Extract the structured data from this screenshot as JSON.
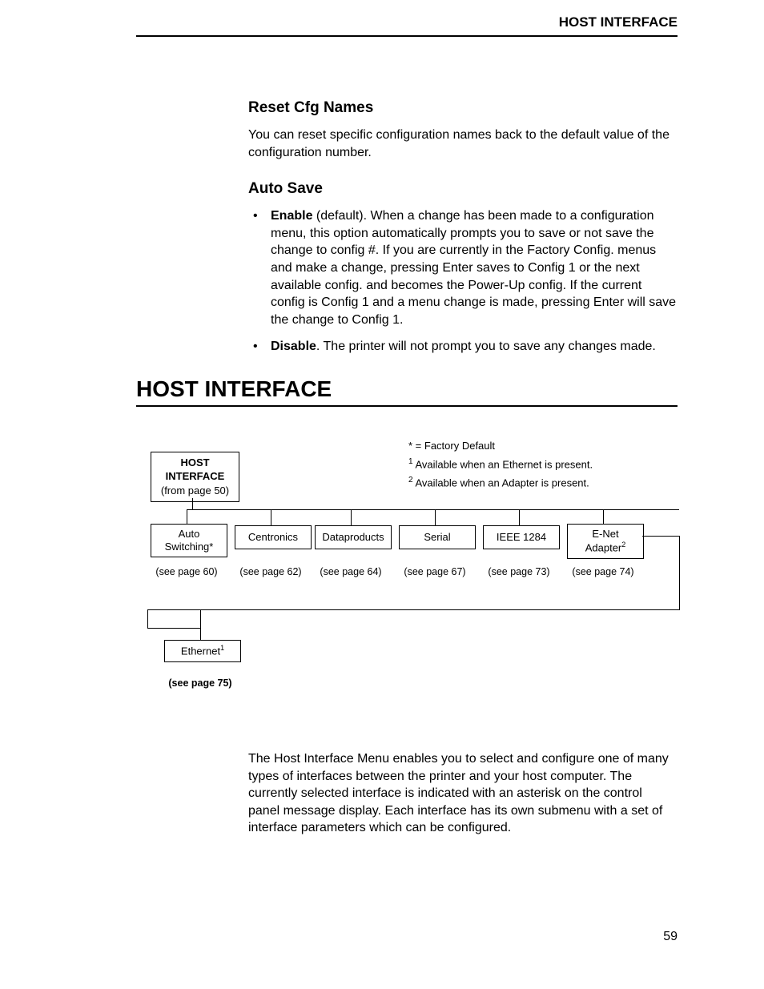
{
  "running_head": "HOST INTERFACE",
  "page_number": "59",
  "section1": {
    "heading": "Reset Cfg Names",
    "para": "You can reset specific configuration names back to the default value of the configuration number."
  },
  "section2": {
    "heading": "Auto Save",
    "bullets": [
      {
        "term": "Enable",
        "rest": " (default). When a change has been made to a configuration menu, this option automatically prompts you to save or not save the change to config #. If you are currently in the Factory Config. menus and make a change, pressing Enter saves to Config 1 or the next available config. and becomes the Power-Up config. If the current config is Config 1 and a menu change is made, pressing Enter will save the change to Config 1."
      },
      {
        "term": "Disable",
        "rest": ". The printer will not prompt you to save any changes made."
      }
    ]
  },
  "banner": "HOST INTERFACE",
  "tree": {
    "root": {
      "line1": "HOST",
      "line2": "INTERFACE",
      "from": "(from page 50)"
    },
    "legend": {
      "l1": "* = Factory Default",
      "l2_pre": "1",
      "l2": " Available when an Ethernet is present.",
      "l3_pre": "2",
      "l3": " Available when an Adapter is present."
    },
    "children": [
      {
        "label": "Auto Switching*",
        "see": "(see page 60)"
      },
      {
        "label": "Centronics",
        "see": "(see page 62)"
      },
      {
        "label": "Dataproducts",
        "see": "(see page 64)"
      },
      {
        "label": "Serial",
        "see": "(see page 67)"
      },
      {
        "label": "IEEE 1284",
        "see": "(see page 73)"
      },
      {
        "label_l1": "E-Net",
        "label_l2": "Adapter",
        "sup": "2",
        "see": "(see page 74)"
      },
      {
        "label": "Ethernet",
        "sup": "1",
        "see": "(see page 75)"
      }
    ]
  },
  "closing_para": "The Host Interface Menu enables you to select and configure one of many types of interfaces between the printer and your host computer. The currently selected interface is indicated with an asterisk on the control panel message display. Each interface has its own submenu with a set of interface parameters which can be configured."
}
